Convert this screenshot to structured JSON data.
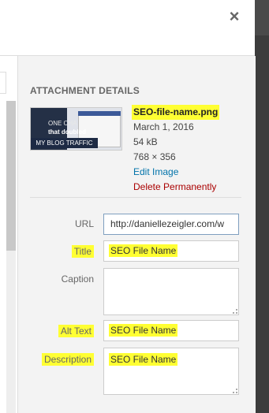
{
  "close_icon_glyph": "×",
  "panel": {
    "heading": "ATTACHMENT DETAILS",
    "thumbnail": {
      "icon": "image-thumbnail",
      "lines": [
        "ONE CHA",
        "that doubled",
        "MY BLOG TRAFFIC"
      ]
    },
    "filename": "SEO-file-name.png",
    "date": "March 1, 2016",
    "size": "54 kB",
    "dimensions": "768 × 356",
    "edit_link": "Edit Image",
    "delete_link": "Delete Permanently"
  },
  "fields": {
    "url": {
      "label": "URL",
      "value": "http://daniellezeigler.com/w"
    },
    "title": {
      "label": "Title",
      "value": "SEO File Name"
    },
    "caption": {
      "label": "Caption",
      "value": ""
    },
    "alt_text": {
      "label": "Alt Text",
      "value": "SEO File Name"
    },
    "description": {
      "label": "Description",
      "value": "SEO File Name"
    }
  },
  "colors": {
    "highlight": "#ffff33",
    "link": "#0073aa",
    "delete": "#aa0000",
    "sidebar_bg": "#f3f3f3"
  }
}
